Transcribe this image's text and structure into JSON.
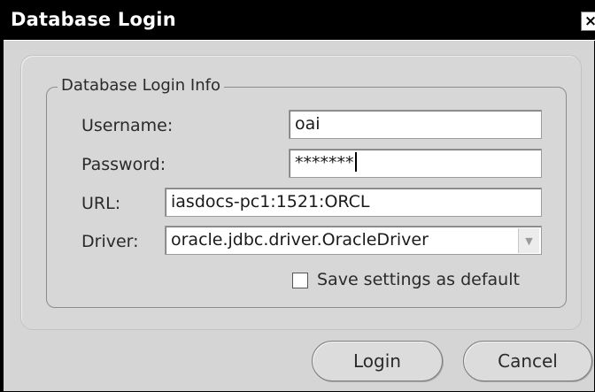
{
  "window": {
    "title": "Database Login",
    "close_glyph": "×"
  },
  "form": {
    "group_label": "Database Login Info",
    "username": {
      "label": "Username:",
      "value": "oai"
    },
    "password": {
      "label": "Password:",
      "value": "*******"
    },
    "url": {
      "label": "URL:",
      "value": "iasdocs-pc1:1521:ORCL"
    },
    "driver": {
      "label": "Driver:",
      "value": "oracle.jdbc.driver.OracleDriver",
      "dropdown_glyph": "▼"
    },
    "save_default": {
      "label": "Save settings as default",
      "checked": false
    }
  },
  "buttons": {
    "login": "Login",
    "cancel": "Cancel"
  },
  "icons": {
    "close": "close-icon",
    "dropdown": "chevron-down-icon"
  }
}
